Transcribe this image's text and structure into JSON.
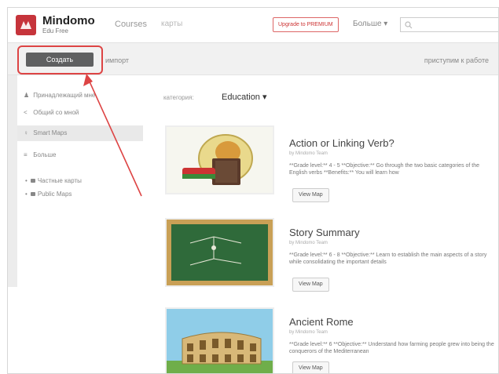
{
  "header": {
    "brand": "Mindomo",
    "brand_sub": "Edu Free",
    "nav_courses": "Courses",
    "nav_maps": "карты",
    "upgrade_label": "Upgrade to PREMIUM",
    "more_label": "Больше ▾",
    "search_placeholder": ""
  },
  "toolbar": {
    "create_label": "Создать",
    "import_label": "импорт",
    "start_work_label": "приступим к работе"
  },
  "sidebar": {
    "items": [
      {
        "label": "Принадлежащий мне",
        "icon": "user-icon"
      },
      {
        "label": "Общий со мной",
        "icon": "share-icon"
      },
      {
        "label": "Smart Maps",
        "icon": "bulb-icon"
      },
      {
        "label": "Больше",
        "icon": "list-icon"
      }
    ],
    "folders": [
      {
        "label": "Частные карты"
      },
      {
        "label": "Public Maps"
      }
    ]
  },
  "main": {
    "category_label": "категория:",
    "category_value": "Education ▾",
    "cards": [
      {
        "title": "Action or Linking Verb?",
        "author": "by Mindomo Team",
        "description": "**Grade level:** 4 - 5 **Objective:** Go through the two basic categories of the English verbs **Benefits:** You will learn how",
        "button": "View Map"
      },
      {
        "title": "Story Summary",
        "author": "by Mindomo Team",
        "description": "**Grade level:** 6 - 8 **Objective:** Learn to establish the main aspects of a story while consolidating the important details",
        "button": "View Map"
      },
      {
        "title": "Ancient Rome",
        "author": "by Mindomo Team",
        "description": "**Grade level:** 6 **Objective:** Understand how farming people grew into being the conquerors of the Mediterranean",
        "button": "View Map"
      }
    ]
  },
  "colors": {
    "brand_red": "#c6343b",
    "annotation_red": "#dd4444"
  }
}
